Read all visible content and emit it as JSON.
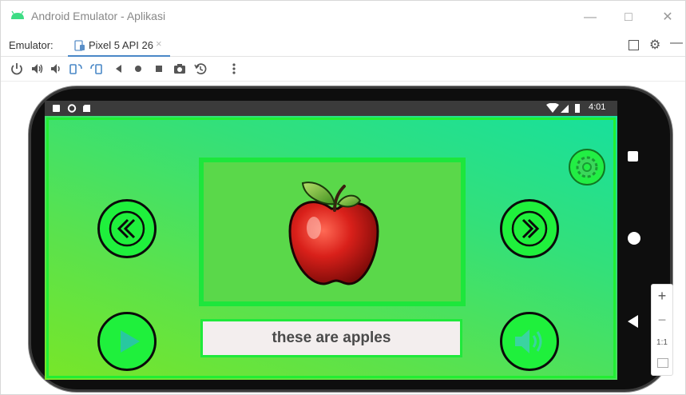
{
  "window": {
    "title": "Android Emulator - Aplikasi",
    "min_glyph": "—",
    "max_glyph": "□",
    "close_glyph": "✕"
  },
  "tabs": {
    "emulator_label": "Emulator:",
    "device_tab_label": "Pixel 5 API 26",
    "close_glyph": "×"
  },
  "toolbar": {
    "items": [
      "power-icon",
      "volume-up-icon",
      "volume-down-icon",
      "rotate-left-icon",
      "rotate-right-icon",
      "back-icon",
      "home-icon",
      "overview-icon",
      "camera-icon",
      "snapshot-icon",
      "more-icon"
    ]
  },
  "device": {
    "status_time": "4:01",
    "app": {
      "caption": "these are apples",
      "image": "apple"
    }
  },
  "zoom": {
    "in": "+",
    "out": "−",
    "one_to_one": "1:1"
  },
  "colors": {
    "accent_green": "#1ff03c",
    "gradient_top": "#15e0a0",
    "gradient_bottom": "#78e628",
    "tab_underline": "#4a88c7"
  }
}
